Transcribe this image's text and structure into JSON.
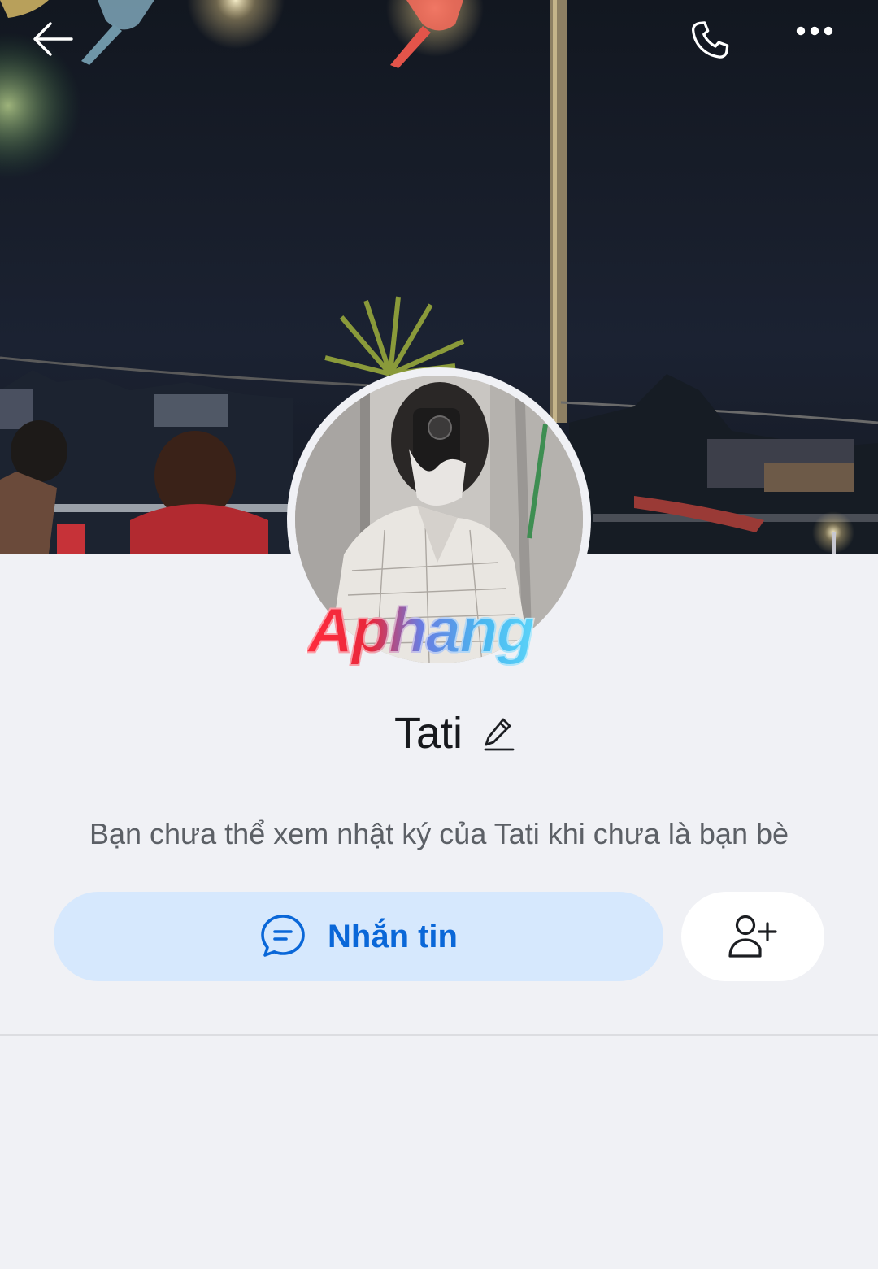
{
  "profile": {
    "name": "Tati",
    "privacy_notice": "Bạn chưa thể xem nhật ký của Tati khi chưa là bạn bè"
  },
  "actions": {
    "message_label": "Nhắn tin"
  },
  "watermark": {
    "text": "Aphang"
  },
  "icons": {
    "back": "arrow-left-icon",
    "call": "phone-icon",
    "more": "more-dots-icon",
    "edit": "pencil-icon",
    "message": "chat-bubble-icon",
    "add_friend": "user-plus-icon"
  },
  "colors": {
    "accent": "#0a67d8",
    "message_button_bg": "#d6e8fd",
    "background": "#f0f1f5",
    "text_primary": "#17191d",
    "text_secondary": "#5c6066"
  }
}
